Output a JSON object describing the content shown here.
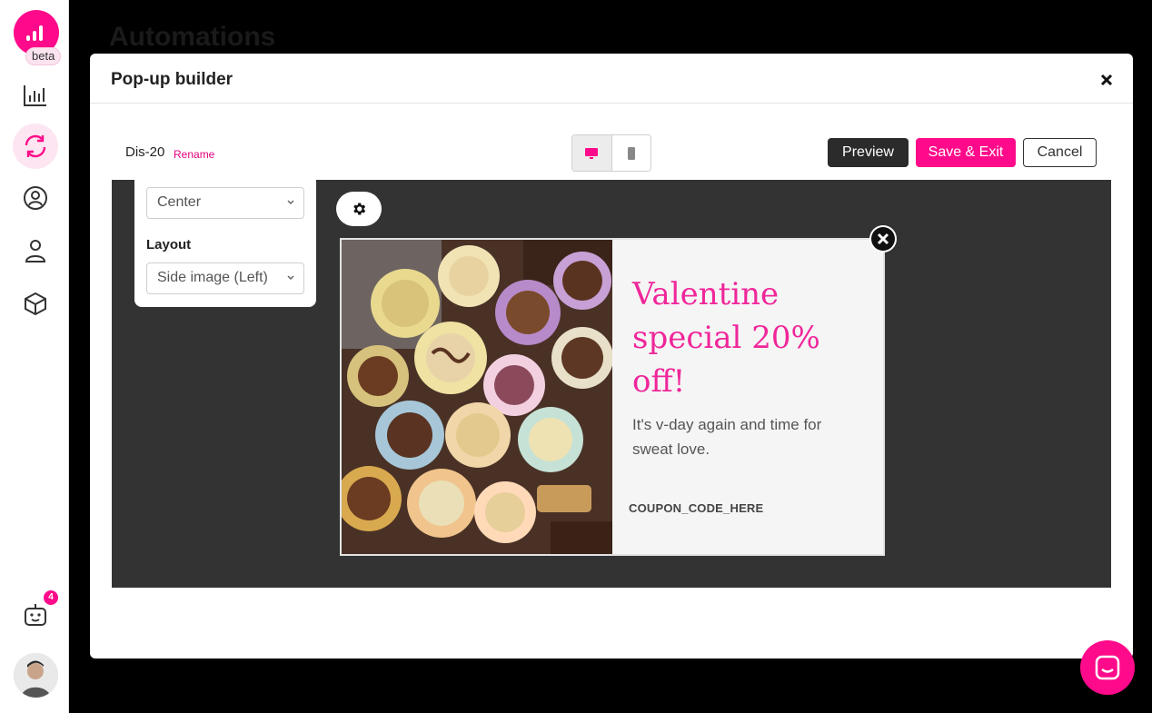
{
  "app": {
    "logo_badge": "beta",
    "background_page_title": "Automations"
  },
  "sidebar": {
    "items": [
      {
        "icon": "analytics-chart-icon"
      },
      {
        "icon": "automations-refresh-icon",
        "active": true
      },
      {
        "icon": "audience-profile-icon"
      },
      {
        "icon": "contact-person-icon"
      },
      {
        "icon": "product-cube-icon"
      }
    ],
    "bot_badge_count": "4"
  },
  "modal": {
    "title": "Pop-up builder",
    "popup_name": "Dis-20",
    "rename_label": "Rename",
    "buttons": {
      "preview": "Preview",
      "save": "Save & Exit",
      "cancel": "Cancel"
    },
    "device_toggle": {
      "selected": "desktop",
      "options": [
        "desktop",
        "mobile"
      ]
    }
  },
  "settings_panel": {
    "position_value": "Center",
    "layout_label": "Layout",
    "layout_value": "Side image (Left)"
  },
  "popup": {
    "headline": "Valentine special 20% off!",
    "body": "It's v-day again and time for sweat love.",
    "coupon": "COUPON_CODE_HERE"
  },
  "colors": {
    "brand": "#ff0a8a",
    "headline": "#f0269a",
    "canvas_bg": "#333333",
    "preview_button": "#2b2b2b"
  }
}
